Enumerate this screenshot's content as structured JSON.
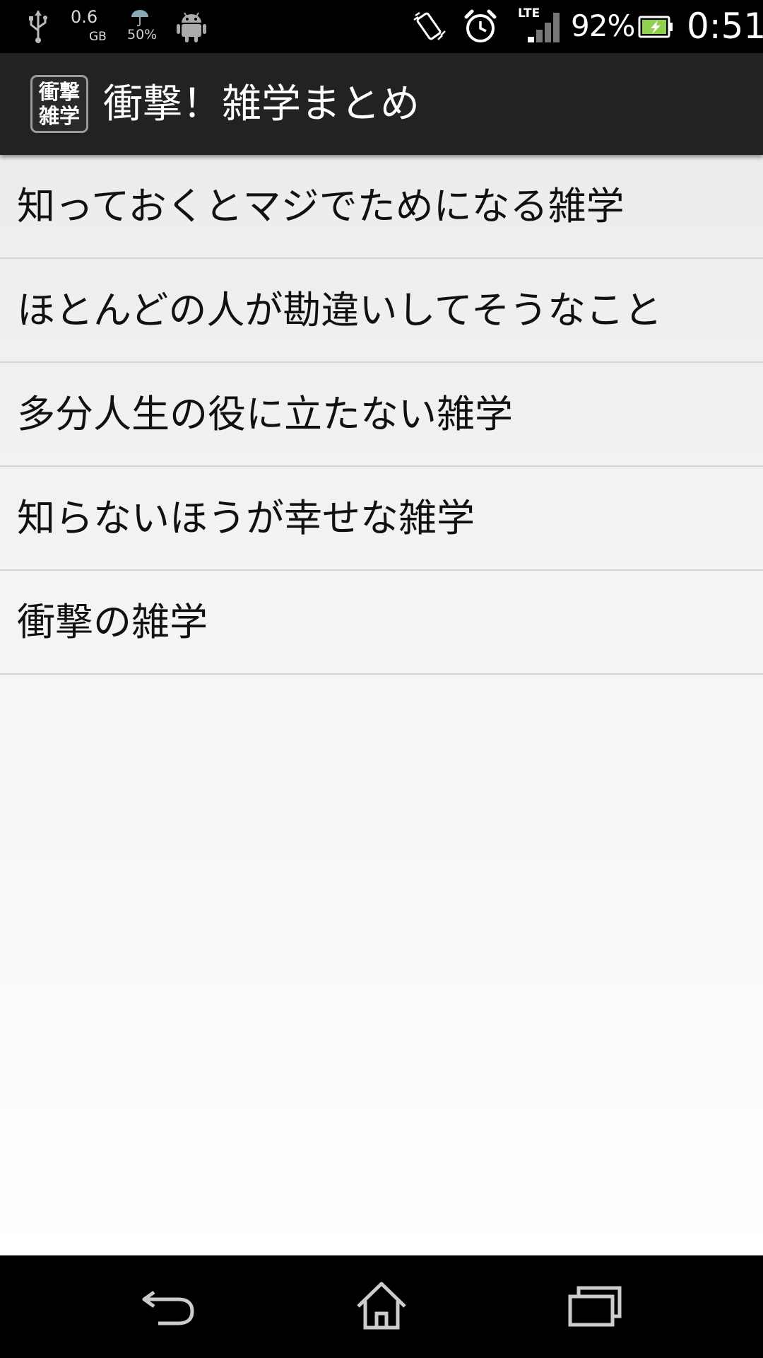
{
  "status_bar": {
    "icons": [
      "usb-icon",
      "weather-icon",
      "android-icon",
      "vibrate-icon",
      "alarm-icon",
      "signal-icon",
      "battery-icon"
    ],
    "data_usage_value": "0.6",
    "data_usage_unit": "GB",
    "weather_percent": "50%",
    "network_type": "LTE",
    "battery_percent": "92%",
    "time": "0:51"
  },
  "app_bar": {
    "icon_line1": "衝撃",
    "icon_line2": "雑学",
    "title": "衝撃！雑学まとめ"
  },
  "list": {
    "items": [
      {
        "label": "知っておくとマジでためになる雑学"
      },
      {
        "label": "ほとんどの人が勘違いしてそうなこと"
      },
      {
        "label": "多分人生の役に立たない雑学"
      },
      {
        "label": "知らないほうが幸せな雑学"
      },
      {
        "label": "衝撃の雑学"
      }
    ]
  },
  "nav_bar": {
    "buttons": [
      "back-icon",
      "home-icon",
      "recent-apps-icon"
    ]
  },
  "colors": {
    "status_bar_bg": "#000000",
    "action_bar_bg": "#222222",
    "list_bg_top": "#ececec",
    "divider": "#d4d4d4",
    "nav_bar_bg": "#000000"
  }
}
